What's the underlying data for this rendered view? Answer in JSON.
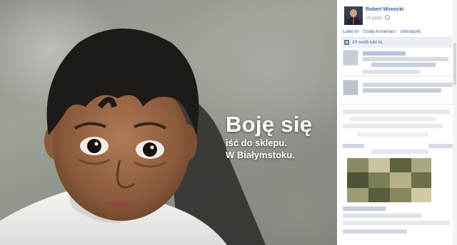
{
  "photo": {
    "caption_big": "Boję się",
    "caption_line2": "iść do sklepu.",
    "caption_line3": "W Białymstoku."
  },
  "post": {
    "author": "Robert Winnicki",
    "timestamp": "15 godz.",
    "actions": [
      "Lubię to!",
      "Dodaj komentarz",
      "Udostępnij"
    ],
    "likes_text": "20 osób lubi to."
  },
  "colors": {
    "link": "#3b5998",
    "likes_bg": "#edeff4"
  },
  "icons": [
    "globe-icon",
    "like-icon"
  ]
}
